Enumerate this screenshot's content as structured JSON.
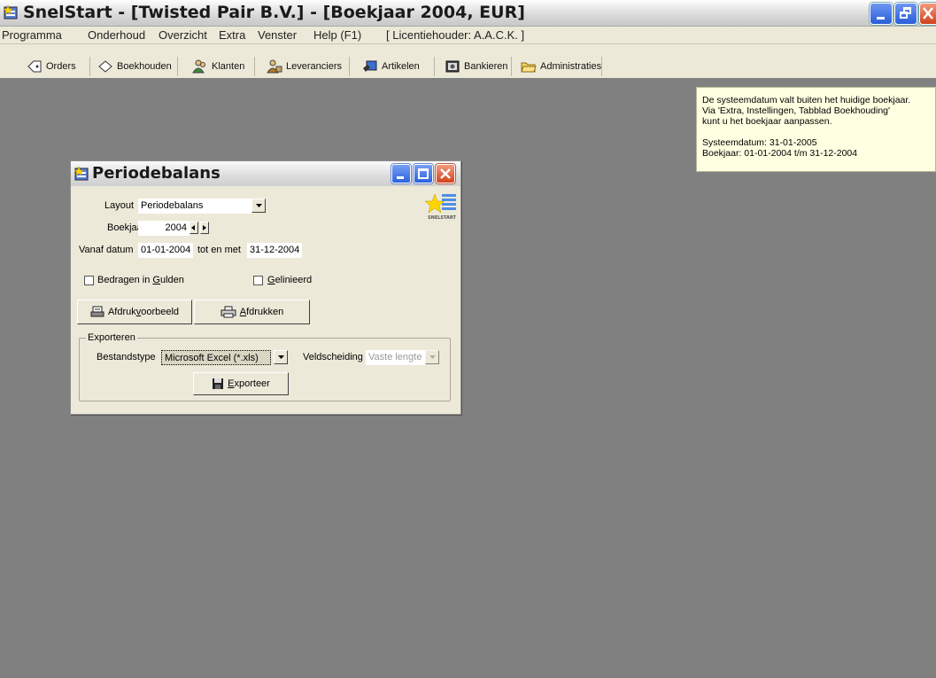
{
  "window": {
    "title": "SnelStart - [Twisted Pair B.V.] - [Boekjaar 2004, EUR]"
  },
  "menu": {
    "items": [
      "Programma",
      "Onderhoud",
      "Overzicht",
      "Extra",
      "Venster",
      "Help (F1)",
      "[ Licentiehouder: A.A.C.K. ]"
    ]
  },
  "toolbar": {
    "orders": "Orders",
    "boekhouden": "Boekhouden",
    "klanten": "Klanten",
    "leveranciers": "Leveranciers",
    "artikelen": "Artikelen",
    "bankieren": "Bankieren",
    "administraties": "Administraties"
  },
  "notice": {
    "line1": "De systeemdatum valt buiten het huidige boekjaar.",
    "line2": "Via 'Extra, Instellingen, Tabblad Boekhouding'",
    "line3": "kunt u het boekjaar aanpassen.",
    "line4": "Systeemdatum: 31-01-2005",
    "line5": "Boekjaar: 01-01-2004 t/m 31-12-2004"
  },
  "dialog": {
    "title": "Periodebalans",
    "logo_text": "SNELSTART",
    "layout_label": "Layout",
    "layout_value": "Periodebalans",
    "boekjaar_label": "Boekjaar",
    "boekjaar_value": "2004",
    "vanaf_label": "Vanaf datum",
    "vanaf_value": "01-01-2004",
    "totenmet_label": "tot en met",
    "totenmet_value": "31-12-2004",
    "gulden_label_pre": "Bedragen in ",
    "gulden_label_u": "G",
    "gulden_label_post": "ulden",
    "gelinieerd_label_u": "G",
    "gelinieerd_label_post": "elinieerd",
    "preview_pre": "Afdruk",
    "preview_u": "v",
    "preview_post": "oorbeeld",
    "print_u": "A",
    "print_post": "fdrukken",
    "export_group": "Exporteren",
    "bestandstype_label": "Bestandstype",
    "bestandstype_value": "Microsoft Excel (*.xls)",
    "veldscheiding_label": "Veldscheiding",
    "veldscheiding_value": "Vaste lengte",
    "export_u": "E",
    "export_post": "xporteer"
  },
  "colors": {
    "desktop": "#808080",
    "dialog_face": "#ece9d8",
    "notice_bg": "#ffffe1",
    "close_button": "#d3431f",
    "window_button": "#2c62dc"
  },
  "icons": [
    "app-star-icon",
    "orders-icon",
    "boekhouden-icon",
    "klanten-icon",
    "leveranciers-icon",
    "artikelen-icon",
    "bankieren-icon",
    "administraties-icon",
    "printer-icon",
    "preview-icon",
    "floppy-icon",
    "snelstart-logo"
  ]
}
